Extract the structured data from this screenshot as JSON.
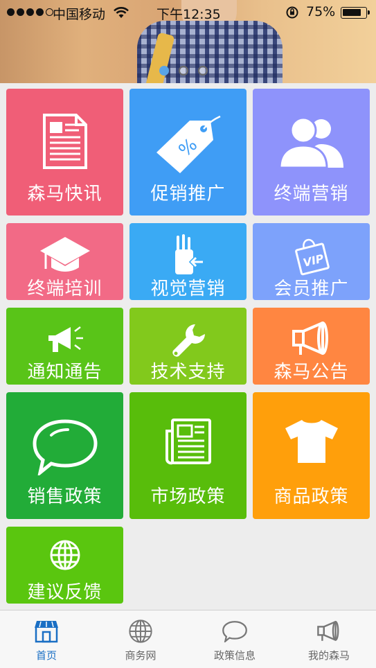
{
  "status_bar": {
    "carrier": "中国移动",
    "time": "下午12:35",
    "battery": "75%",
    "battery_level": 0.75
  },
  "carousel": {
    "page_count": 3,
    "active_index": 0
  },
  "tiles": [
    {
      "label": "森马快讯",
      "icon": "news-document-icon",
      "color": "#f05e77"
    },
    {
      "label": "促销推广",
      "icon": "price-tag-icon",
      "color": "#3f9df5"
    },
    {
      "label": "终端营销",
      "icon": "users-icon",
      "color": "#8e93fb"
    },
    {
      "label": "终端培训",
      "icon": "graduation-cap-icon",
      "color": "#f26a86"
    },
    {
      "label": "视觉营销",
      "icon": "paint-brushes-icon",
      "color": "#3aaaf4"
    },
    {
      "label": "会员推广",
      "icon": "vip-card-icon",
      "color": "#7da2fb"
    },
    {
      "label": "通知通告",
      "icon": "megaphone-icon",
      "color": "#59c418"
    },
    {
      "label": "技术支持",
      "icon": "wrench-icon",
      "color": "#82c91c"
    },
    {
      "label": "森马公告",
      "icon": "loudspeaker-icon",
      "color": "#ff8641"
    },
    {
      "label": "销售政策",
      "icon": "chat-bubble-icon",
      "color": "#22ac38"
    },
    {
      "label": "市场政策",
      "icon": "newspaper-icon",
      "color": "#58bd0b"
    },
    {
      "label": "商品政策",
      "icon": "t-shirt-icon",
      "color": "#ff9f0b"
    },
    {
      "label": "建议反馈",
      "icon": "globe-icon",
      "color": "#5ac60f"
    }
  ],
  "tabbar": {
    "items": [
      {
        "label": "首页",
        "icon": "store-icon",
        "active": true
      },
      {
        "label": "商务网",
        "icon": "globe-icon",
        "active": false
      },
      {
        "label": "政策信息",
        "icon": "chat-bubble-icon",
        "active": false
      },
      {
        "label": "我的森马",
        "icon": "loudspeaker-icon",
        "active": false
      }
    ],
    "active_color": "#1a6fc4"
  }
}
